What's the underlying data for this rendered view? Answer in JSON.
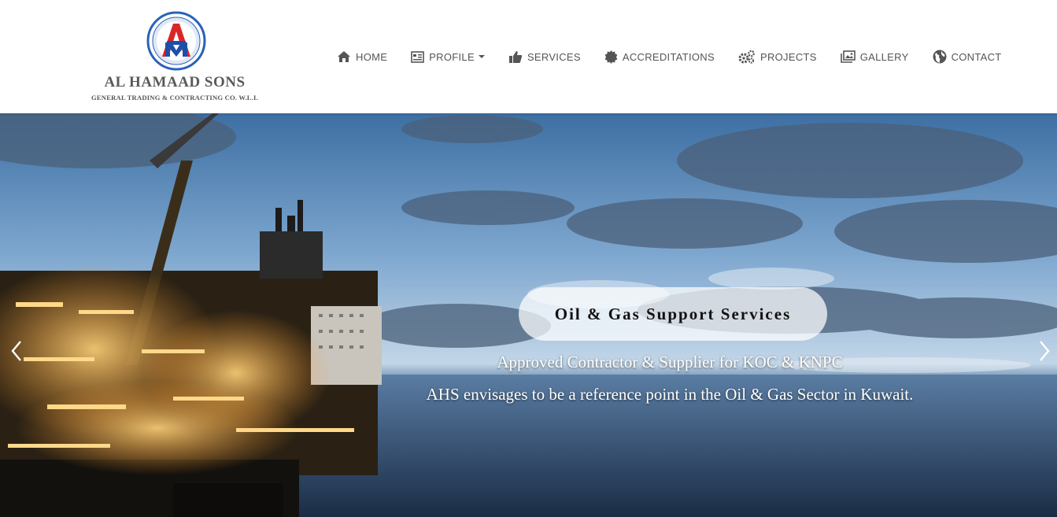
{
  "brand": {
    "name": "AL HAMAAD SONS",
    "subtitle": "GENERAL TRADING & CONTRACTING CO. W.L.L",
    "emblem_letters": "AM",
    "colors": {
      "ring": "#2a62b8",
      "red": "#d9262a",
      "blue": "#1e4fa8"
    }
  },
  "nav": {
    "items": [
      {
        "label": "HOME",
        "icon": "home-icon"
      },
      {
        "label": "PROFILE",
        "icon": "profile-icon",
        "dropdown": true
      },
      {
        "label": "SERVICES",
        "icon": "thumbs-up-icon"
      },
      {
        "label": "ACCREDITATIONS",
        "icon": "certificate-icon"
      },
      {
        "label": "PROJECTS",
        "icon": "gears-icon"
      },
      {
        "label": "GALLERY",
        "icon": "gallery-icon"
      },
      {
        "label": "CONTACT",
        "icon": "globe-icon"
      }
    ]
  },
  "hero": {
    "title": "Oil & Gas Support Services",
    "line1": "Approved Contractor & Supplier for KOC & KNPC",
    "line2": "AHS envisages to be a reference point in the Oil & Gas Sector in Kuwait.",
    "prev_icon": "chevron-left-icon",
    "next_icon": "chevron-right-icon"
  }
}
